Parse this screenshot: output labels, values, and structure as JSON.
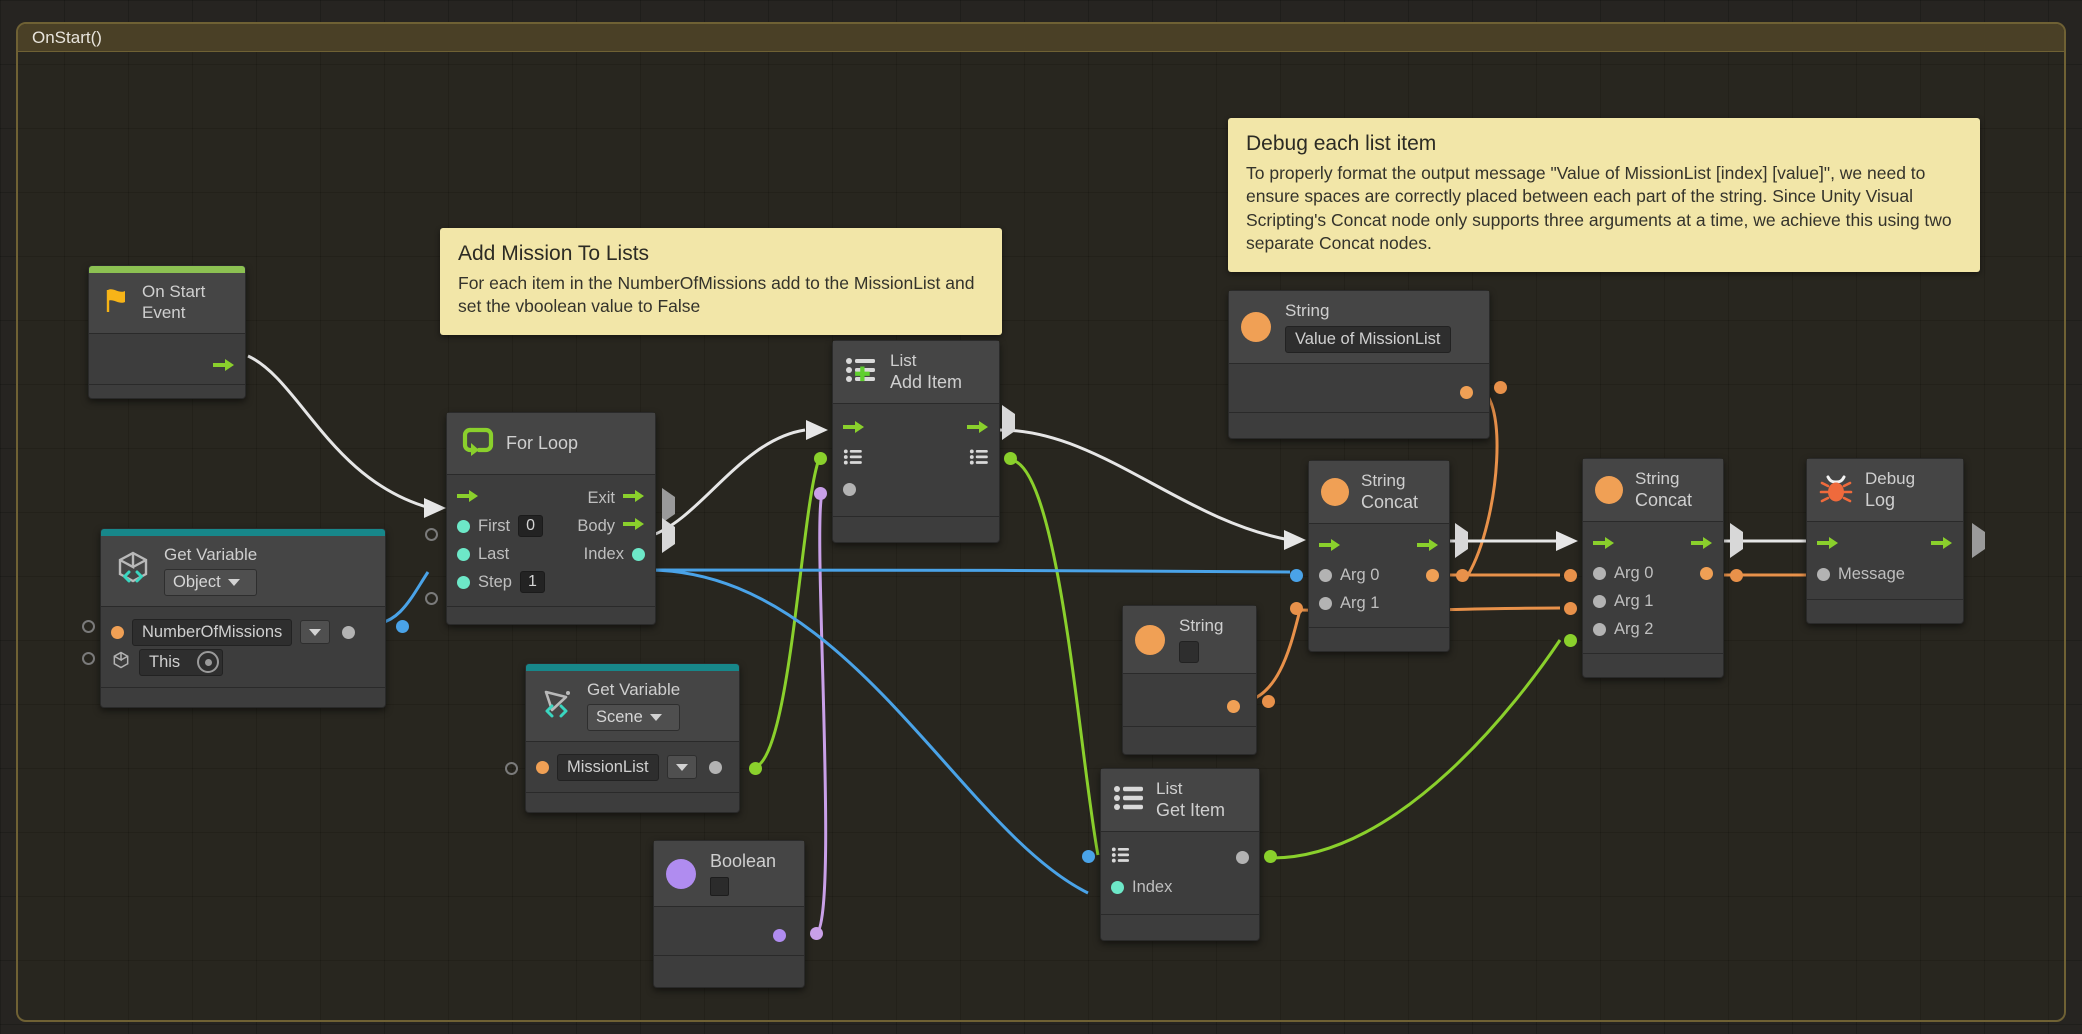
{
  "graph": {
    "group_title": "OnStart()"
  },
  "notes": [
    {
      "id": "add-mission-note",
      "title": "Add Mission To Lists",
      "body": "For each item in the NumberOfMissions add to the MissionList and set the vboolean value to False"
    },
    {
      "id": "debug-note",
      "title": "Debug each list item",
      "body": "To properly format the output message \"Value of MissionList [index] [value]\", we need to ensure spaces are correctly placed between each part of the string. Since Unity Visual Scripting's Concat node only supports three arguments at a time, we achieve this using two separate Concat nodes."
    }
  ],
  "nodes": {
    "on_start": {
      "title": "On Start",
      "subtitle": "Event",
      "icon": "flag-icon",
      "accent": "#8cc152"
    },
    "get_variable_object": {
      "title": "Get Variable",
      "scope": "Object",
      "icon": "object-variable-icon",
      "accent": "#17878a",
      "variable": "NumberOfMissions",
      "target": "This"
    },
    "for_loop": {
      "title": "For Loop",
      "icon": "loop-icon",
      "in_first": "First",
      "in_last": "Last",
      "in_step": "Step",
      "first_value": "0",
      "step_value": "1",
      "out_exit": "Exit",
      "out_body": "Body",
      "out_index": "Index"
    },
    "get_variable_scene": {
      "title": "Get Variable",
      "scope": "Scene",
      "icon": "scene-variable-icon",
      "accent": "#17878a",
      "variable": "MissionList"
    },
    "list_add_item": {
      "title": "List",
      "subtitle": "Add Item",
      "icon": "list-add-icon"
    },
    "list_get_item": {
      "title": "List",
      "subtitle": "Get Item",
      "icon": "list-get-icon",
      "index_label": "Index"
    },
    "boolean": {
      "title": "Boolean",
      "icon": "boolean-icon",
      "value": false
    },
    "string_value": {
      "title": "String",
      "icon": "string-icon",
      "value": "Value of MissionList"
    },
    "string_empty": {
      "title": "String",
      "icon": "string-icon",
      "value": ""
    },
    "concat_a": {
      "title": "String",
      "subtitle": "Concat",
      "icon": "string-icon",
      "args": [
        "Arg 0",
        "Arg 1"
      ]
    },
    "concat_b": {
      "title": "String",
      "subtitle": "Concat",
      "icon": "string-icon",
      "args": [
        "Arg 0",
        "Arg 1",
        "Arg 2"
      ]
    },
    "debug_log": {
      "title": "Debug",
      "subtitle": "Log",
      "icon": "bug-icon",
      "message_label": "Message"
    }
  },
  "colors": {
    "flow_wire": "#e6e6e6",
    "list_wire": "#8ad02c",
    "string_wire": "#e8914a",
    "int_wire": "#4aa3e8",
    "bool_wire": "#c9a0e8",
    "note_bg": "#f2e6a8",
    "canvas_bg": "#262421"
  }
}
